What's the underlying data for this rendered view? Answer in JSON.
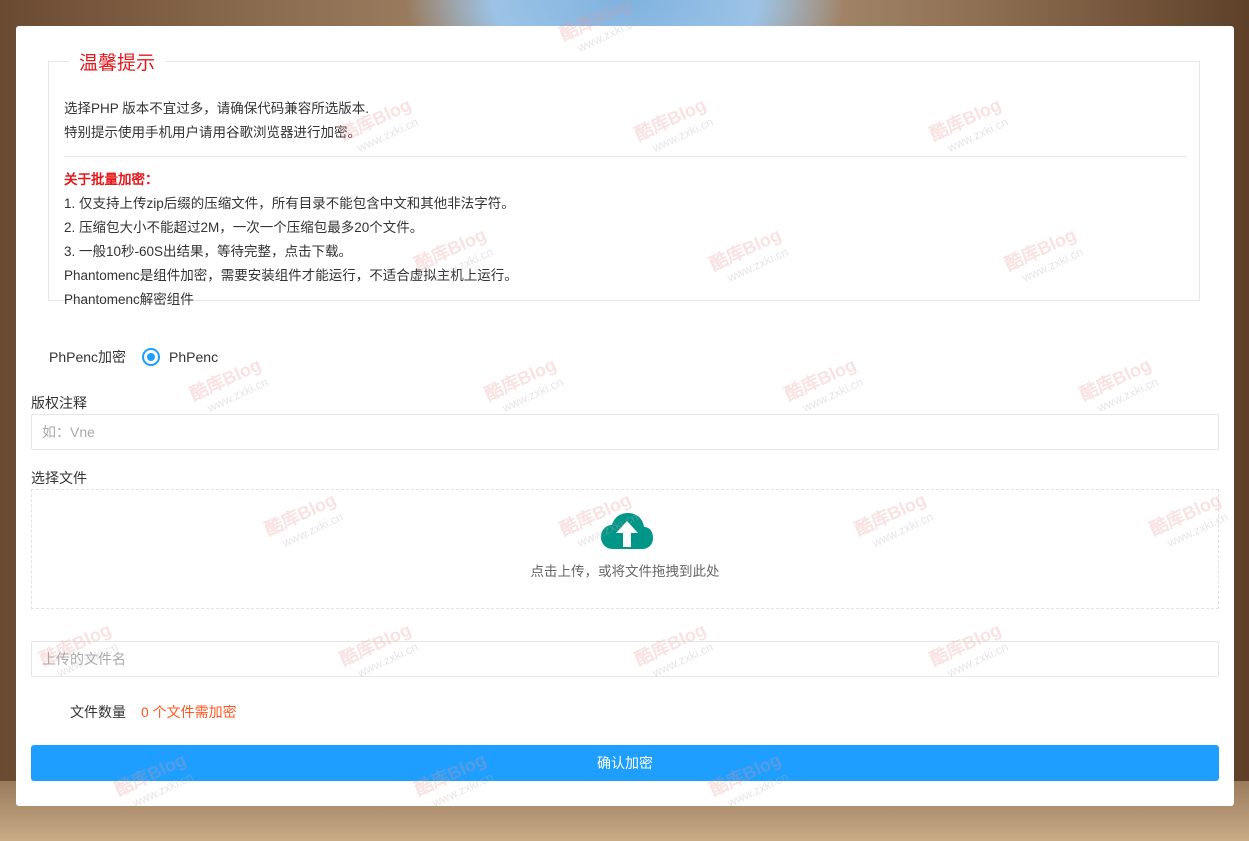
{
  "tips": {
    "title": "温馨提示",
    "lines_top": [
      "选择PHP 版本不宜过多，请确保代码兼容所选版本.",
      "特别提示使用手机用户请用谷歌浏览器进行加密。"
    ],
    "batch_title": "关于批量加密：",
    "lines_bottom": [
      "1. 仅支持上传zip后缀的压缩文件，所有目录不能包含中文和其他非法字符。",
      "2. 压缩包大小不能超过2M，一次一个压缩包最多20个文件。",
      "3. 一般10秒-60S出结果，等待完整，点击下载。",
      "Phantomenc是组件加密，需要安装组件才能运行，不适合虚拟主机上运行。",
      "Phantomenc解密组件"
    ]
  },
  "encrypt": {
    "label": "PhPenc加密",
    "option": "PhPenc"
  },
  "copyright": {
    "label": "版权注释",
    "placeholder": "如：Vne"
  },
  "upload": {
    "label": "选择文件",
    "hint": "点击上传，或将文件拖拽到此处",
    "filename_placeholder": "上传的文件名"
  },
  "count": {
    "label": "文件数量",
    "value": "0 个文件需加密"
  },
  "submit_label": "确认加密",
  "watermark": {
    "brand": "酷库Blog",
    "url": "www.zxki.cn"
  },
  "colors": {
    "accent": "#1e9fff",
    "tips_red": "#e5191c",
    "count_orange": "#ff5722",
    "upload_icon": "#009688"
  }
}
